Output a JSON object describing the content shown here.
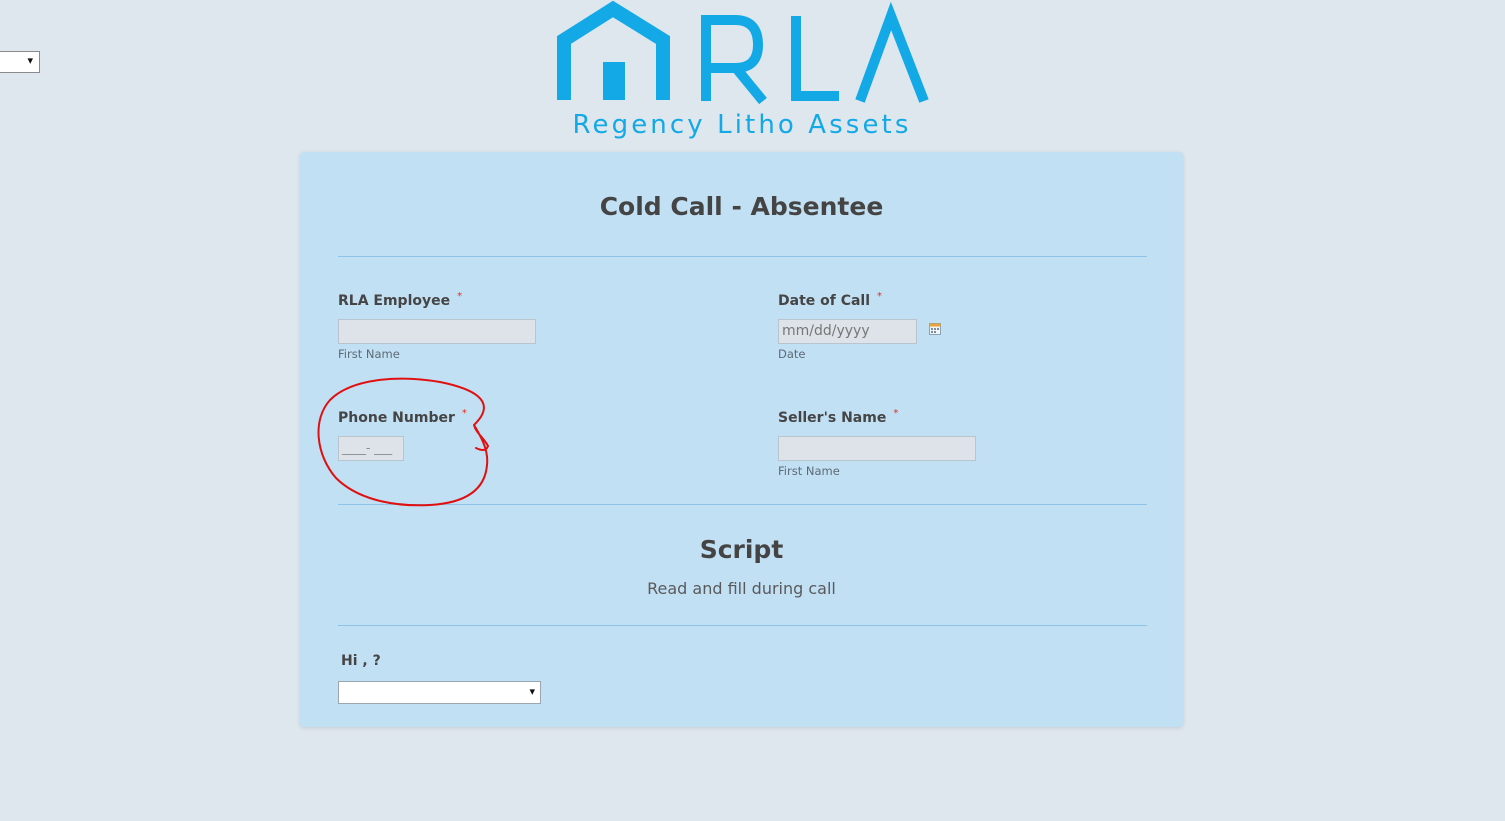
{
  "language_selector": {
    "value": "",
    "arrow": "▾"
  },
  "logo": {
    "letters": "RLA",
    "tagline": "Regency Litho Assets",
    "brand_color": "#12a9e6"
  },
  "form": {
    "title": "Cold Call - Absentee",
    "required_marker": "*",
    "fields": {
      "employee": {
        "label": "RLA Employee",
        "value": "",
        "sublabel": "First Name"
      },
      "date_of_call": {
        "label": "Date of Call",
        "placeholder": "mm/dd/yyyy",
        "sublabel": "Date",
        "icon": "calendar-icon"
      },
      "phone": {
        "label": "Phone Number",
        "mask": "____- ___"
      },
      "seller_name": {
        "label": "Seller's Name",
        "value": "",
        "sublabel": "First Name"
      }
    },
    "script_section": {
      "title": "Script",
      "subtitle": "Read and fill during call"
    },
    "greeting": {
      "label": "Hi , ?",
      "selected": "",
      "arrow": "▾"
    }
  },
  "colors": {
    "page_background": "#dfe7ee",
    "card_background": "#c2e0f4",
    "required": "#e32b1e",
    "annotation": "#e01010"
  }
}
